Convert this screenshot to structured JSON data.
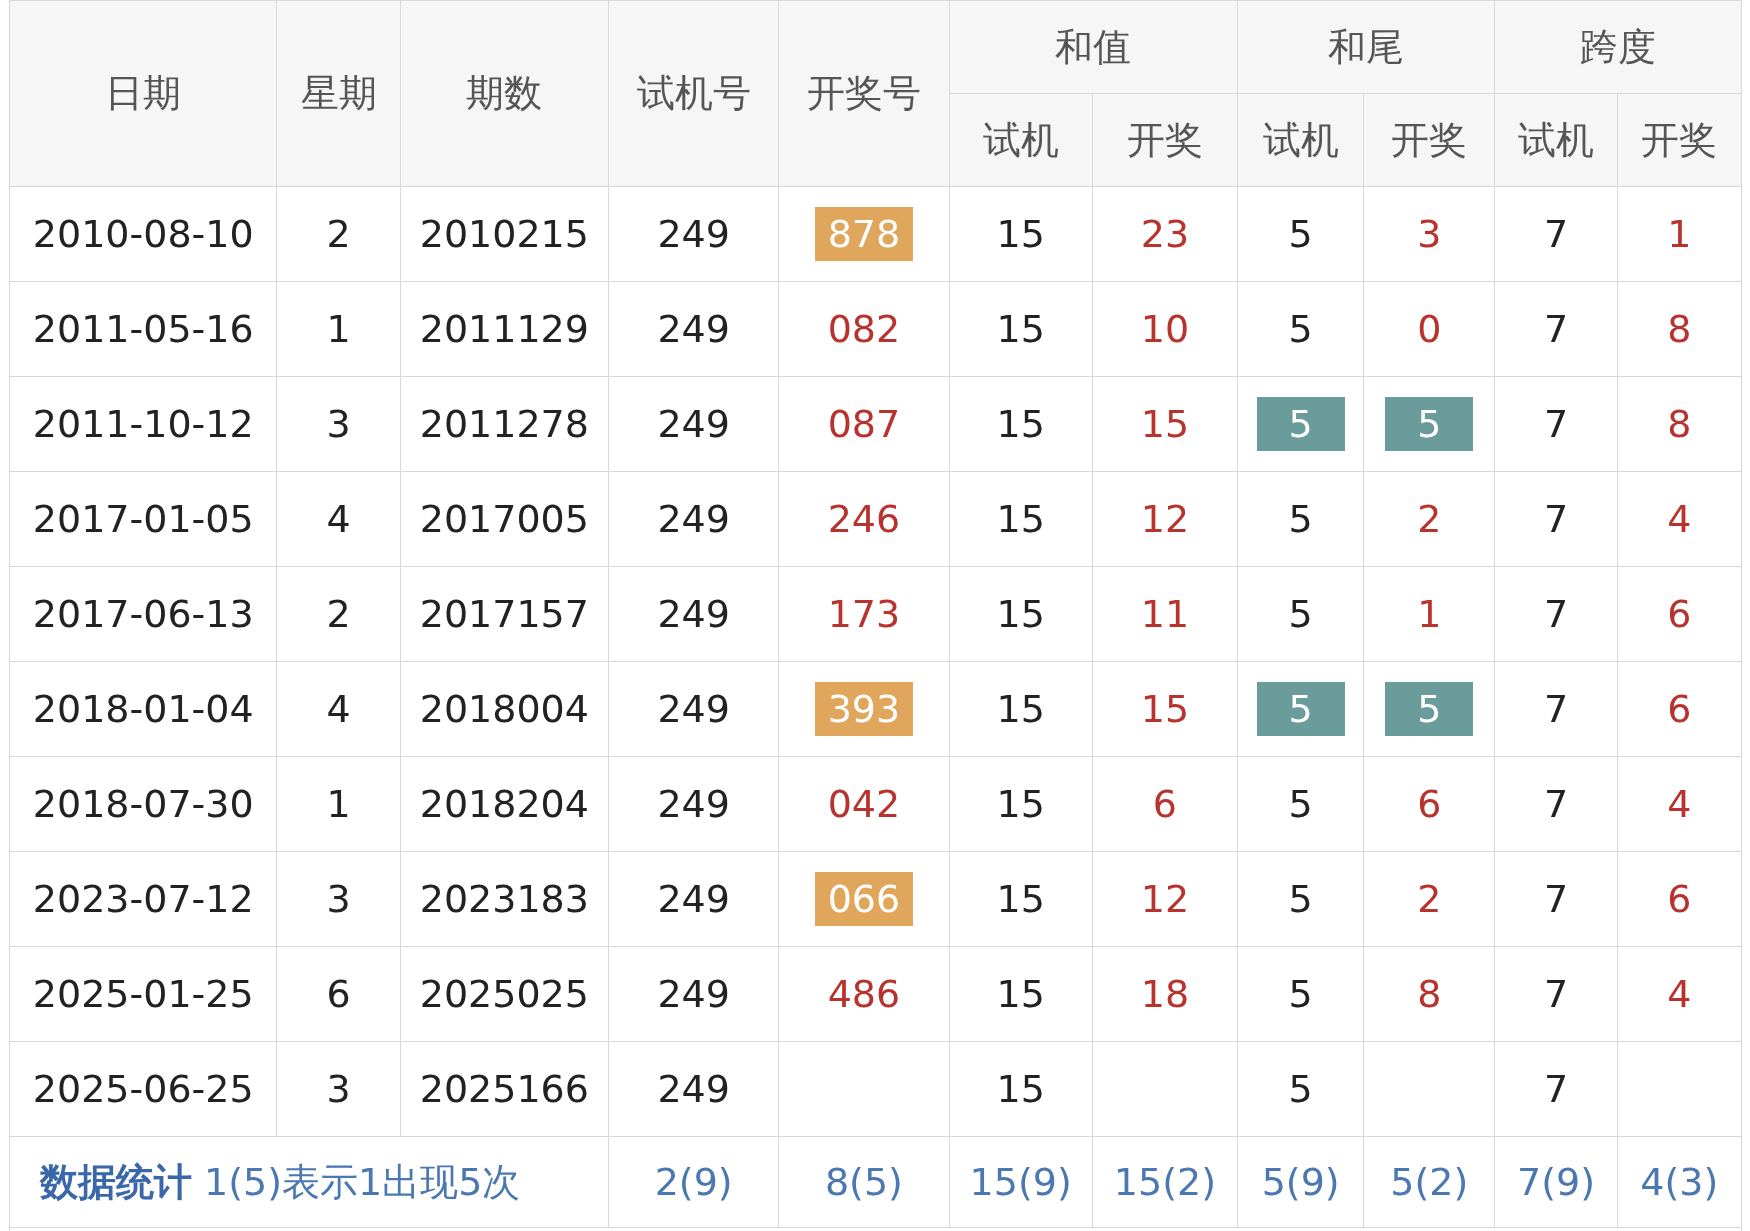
{
  "table": {
    "columns": [
      {
        "label": "日期"
      },
      {
        "label": "星期"
      },
      {
        "label": "期数"
      },
      {
        "label": "试机号"
      },
      {
        "label": "开奖号"
      }
    ],
    "groups": [
      {
        "label": "和值",
        "sub": [
          "试机",
          "开奖"
        ]
      },
      {
        "label": "和尾",
        "sub": [
          "试机",
          "开奖"
        ]
      },
      {
        "label": "跨度",
        "sub": [
          "试机",
          "开奖"
        ]
      }
    ],
    "rows": [
      {
        "date": "2010-08-10",
        "weekday": "2",
        "issue": "2010215",
        "test": "249",
        "draw": {
          "text": "878",
          "kind": "hot"
        },
        "sum_test": "15",
        "sum_draw": "23",
        "tail_test": {
          "text": "5",
          "kind": "plain"
        },
        "tail_draw": {
          "text": "3",
          "kind": "plain"
        },
        "span_test": "7",
        "span_draw": "1"
      },
      {
        "date": "2011-05-16",
        "weekday": "1",
        "issue": "2011129",
        "test": "249",
        "draw": {
          "text": "082",
          "kind": "plain"
        },
        "sum_test": "15",
        "sum_draw": "10",
        "tail_test": {
          "text": "5",
          "kind": "plain"
        },
        "tail_draw": {
          "text": "0",
          "kind": "plain"
        },
        "span_test": "7",
        "span_draw": "8"
      },
      {
        "date": "2011-10-12",
        "weekday": "3",
        "issue": "2011278",
        "test": "249",
        "draw": {
          "text": "087",
          "kind": "plain"
        },
        "sum_test": "15",
        "sum_draw": "15",
        "tail_test": {
          "text": "5",
          "kind": "match"
        },
        "tail_draw": {
          "text": "5",
          "kind": "match"
        },
        "span_test": "7",
        "span_draw": "8"
      },
      {
        "date": "2017-01-05",
        "weekday": "4",
        "issue": "2017005",
        "test": "249",
        "draw": {
          "text": "246",
          "kind": "plain"
        },
        "sum_test": "15",
        "sum_draw": "12",
        "tail_test": {
          "text": "5",
          "kind": "plain"
        },
        "tail_draw": {
          "text": "2",
          "kind": "plain"
        },
        "span_test": "7",
        "span_draw": "4"
      },
      {
        "date": "2017-06-13",
        "weekday": "2",
        "issue": "2017157",
        "test": "249",
        "draw": {
          "text": "173",
          "kind": "plain"
        },
        "sum_test": "15",
        "sum_draw": "11",
        "tail_test": {
          "text": "5",
          "kind": "plain"
        },
        "tail_draw": {
          "text": "1",
          "kind": "plain"
        },
        "span_test": "7",
        "span_draw": "6"
      },
      {
        "date": "2018-01-04",
        "weekday": "4",
        "issue": "2018004",
        "test": "249",
        "draw": {
          "text": "393",
          "kind": "hot"
        },
        "sum_test": "15",
        "sum_draw": "15",
        "tail_test": {
          "text": "5",
          "kind": "match"
        },
        "tail_draw": {
          "text": "5",
          "kind": "match"
        },
        "span_test": "7",
        "span_draw": "6"
      },
      {
        "date": "2018-07-30",
        "weekday": "1",
        "issue": "2018204",
        "test": "249",
        "draw": {
          "text": "042",
          "kind": "plain"
        },
        "sum_test": "15",
        "sum_draw": "6",
        "tail_test": {
          "text": "5",
          "kind": "plain"
        },
        "tail_draw": {
          "text": "6",
          "kind": "plain"
        },
        "span_test": "7",
        "span_draw": "4"
      },
      {
        "date": "2023-07-12",
        "weekday": "3",
        "issue": "2023183",
        "test": "249",
        "draw": {
          "text": "066",
          "kind": "hot"
        },
        "sum_test": "15",
        "sum_draw": "12",
        "tail_test": {
          "text": "5",
          "kind": "plain"
        },
        "tail_draw": {
          "text": "2",
          "kind": "plain"
        },
        "span_test": "7",
        "span_draw": "6"
      },
      {
        "date": "2025-01-25",
        "weekday": "6",
        "issue": "2025025",
        "test": "249",
        "draw": {
          "text": "486",
          "kind": "plain"
        },
        "sum_test": "15",
        "sum_draw": "18",
        "tail_test": {
          "text": "5",
          "kind": "plain"
        },
        "tail_draw": {
          "text": "8",
          "kind": "plain"
        },
        "span_test": "7",
        "span_draw": "4"
      },
      {
        "date": "2025-06-25",
        "weekday": "3",
        "issue": "2025166",
        "test": "249",
        "sum_test": "15",
        "tail_test": {
          "text": "5",
          "kind": "plain"
        },
        "span_test": "7"
      }
    ],
    "footer": {
      "note": "**数据统计** 1(5)表示1出现5次",
      "stats": [
        "2(9)",
        "8(5)",
        "15(9)",
        "15(2)",
        "5(9)",
        "5(2)",
        "7(9)",
        "4(3)"
      ]
    }
  }
}
